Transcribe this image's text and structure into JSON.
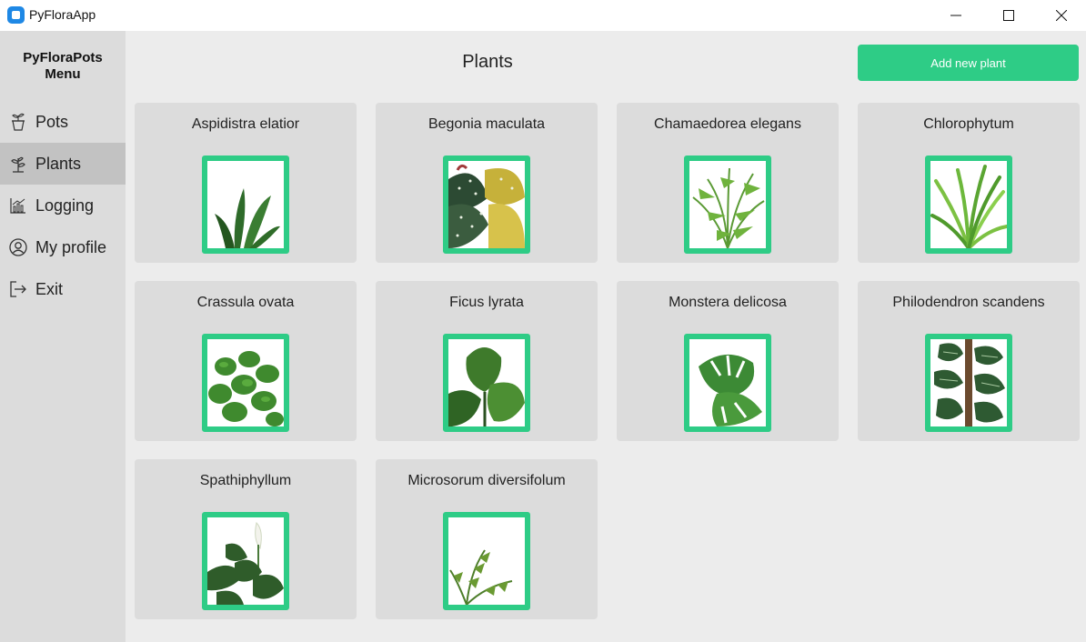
{
  "window": {
    "title": "PyFloraApp"
  },
  "sidebar": {
    "title": "PyFloraPots Menu",
    "items": [
      {
        "label": "Pots",
        "icon": "pot-icon"
      },
      {
        "label": "Plants",
        "icon": "plant-icon",
        "active": true
      },
      {
        "label": "Logging",
        "icon": "chart-icon"
      },
      {
        "label": "My profile",
        "icon": "profile-icon"
      },
      {
        "label": "Exit",
        "icon": "exit-icon"
      }
    ]
  },
  "header": {
    "title": "Plants",
    "add_label": "Add new plant"
  },
  "colors": {
    "accent": "#2ecc86",
    "sidebar": "#dcdcdc",
    "active": "#c2c2c2",
    "content": "#ececec"
  },
  "plants": [
    {
      "name": "Aspidistra elatior"
    },
    {
      "name": "Begonia maculata"
    },
    {
      "name": "Chamaedorea elegans"
    },
    {
      "name": "Chlorophytum"
    },
    {
      "name": "Crassula ovata"
    },
    {
      "name": "Ficus lyrata"
    },
    {
      "name": "Monstera delicosa"
    },
    {
      "name": "Philodendron scandens"
    },
    {
      "name": "Spathiphyllum"
    },
    {
      "name": "Microsorum diversifolum"
    }
  ]
}
